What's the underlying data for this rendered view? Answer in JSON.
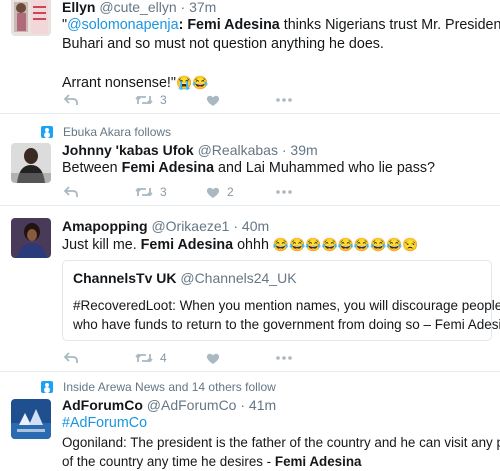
{
  "tweets": [
    {
      "name": "Ellyn",
      "handle": "@cute_ellyn",
      "time": "· 37m",
      "mention": "@solomonapenja",
      "colon": ":",
      "bold": "Femi Adesina",
      "line1_rest": "thinks Nigerians trust Mr. President",
      "line2": "Buhari and so must not question anything he does.",
      "line3": "Arrant nonsense!\"",
      "emojis": "😭😂",
      "retweets": "3",
      "likes": ""
    },
    {
      "context": "Ebuka Akara follows",
      "name": "Johnny 'kabas Ufok",
      "handle": "@Realkabas",
      "time": "· 39m",
      "pre": "Between",
      "bold": "Femi Adesina",
      "post": "and Lai Muhammed who lie pass?",
      "retweets": "3",
      "likes": "2"
    },
    {
      "name": "Amapopping",
      "handle": "@Orikaeze1",
      "time": "· 40m",
      "pre": "Just kill me.",
      "bold": "Femi Adesina",
      "post": "ohhh",
      "emojis": "😂😂😂😂😂😂😂😂😒",
      "quote": {
        "name": "ChannelsTv UK",
        "handle": "@Channels24_UK",
        "line1": "#RecoveredLoot: When you mention names, you will discourage people",
        "line2": "who have funds to return to the government from doing so – Femi Adesina"
      },
      "retweets": "4",
      "likes": ""
    },
    {
      "context": "Inside Arewa News and 14 others follow",
      "name": "AdForumCo",
      "handle": "@AdForumCo",
      "time": "· 41m",
      "hashtag": "#AdForumCo",
      "line1": "Ogoniland: The president is the father of the country and he can visit any part",
      "line2_pre": "of the country any time he desires -",
      "bold": "Femi Adesina"
    }
  ],
  "colors": {
    "link": "#1b95e0",
    "muted": "#657786",
    "icon": "#8899a6",
    "border": "#e6ecf0"
  }
}
